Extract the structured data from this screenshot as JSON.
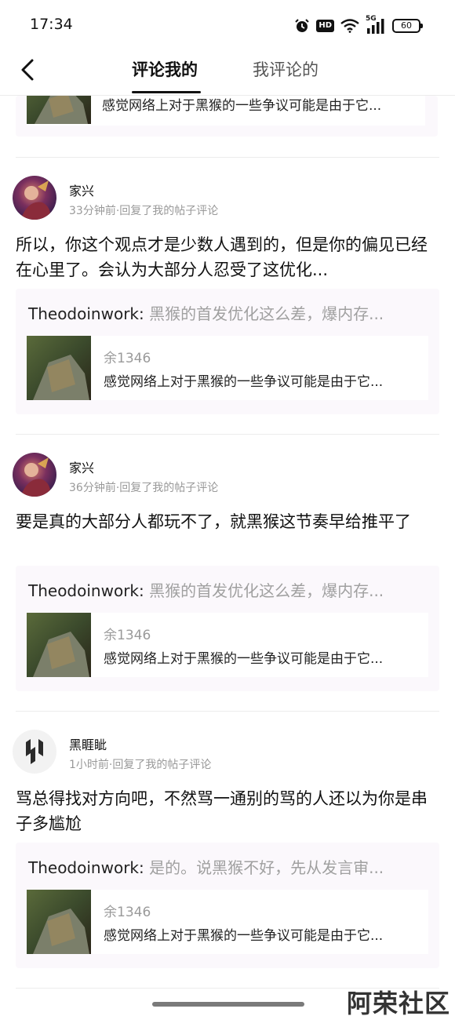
{
  "status_bar": {
    "time": "17:34",
    "signal_label": "5G",
    "hd_label": "HD",
    "battery": "60"
  },
  "nav": {
    "tabs": [
      {
        "label": "评论我的",
        "active": true
      },
      {
        "label": "我评论的",
        "active": false
      }
    ]
  },
  "partial_post": {
    "title": "感觉网络上对于黑猴的一些争议可能是由于它..."
  },
  "comments": [
    {
      "username": "家兴",
      "meta": "33分钟前·回复了我的帖子评论",
      "body": "所以，你这个观点才是少数人遇到的，但是你的偏见已经在心里了。会认为大部分人忍受了这优化...",
      "reply_author": "Theodoinwork:",
      "reply_quote": "黑猴的首发优化这么差，爆内存...",
      "post_author": "余1346",
      "post_title": "感觉网络上对于黑猴的一些争议可能是由于它..."
    },
    {
      "username": "家兴",
      "meta": "36分钟前·回复了我的帖子评论",
      "body": "要是真的大部分人都玩不了，就黑猴这节奏早给推平了",
      "reply_author": "Theodoinwork:",
      "reply_quote": "黑猴的首发优化这么差，爆内存...",
      "post_author": "余1346",
      "post_title": "感觉网络上对于黑猴的一些争议可能是由于它..."
    },
    {
      "username": "黑睚眦",
      "meta": "1小时前·回复了我的帖子评论",
      "body": "骂总得找对方向吧，不然骂一通别的骂的人还以为你是串子多尴尬",
      "reply_author": "Theodoinwork:",
      "reply_quote": "是的。说黑猴不好，先从发言审...",
      "post_author": "余1346",
      "post_title": "感觉网络上对于黑猴的一些争议可能是由于它..."
    }
  ],
  "watermark": "阿荣社区",
  "colors": {
    "card_bg": "#fbf8fc",
    "muted_text": "#999999",
    "quote_text": "#a0a0a0"
  }
}
